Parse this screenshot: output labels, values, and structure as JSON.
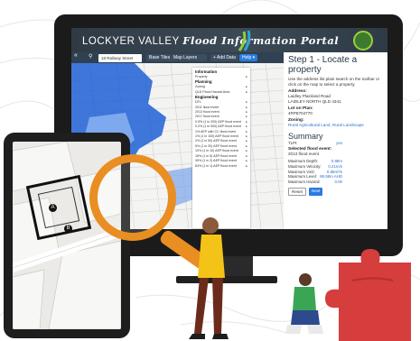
{
  "app": {
    "title_prefix": "LOCKYER VALLEY",
    "title_suffix": "Flood Information Portal"
  },
  "toolbar": {
    "search_value": "18 Railway Street",
    "base_tiles_label": "Base Tiles ▾",
    "map_layers_label": "Map Layers ▾",
    "add_data_label": "+ Add Data",
    "help_label": "Help ▾"
  },
  "layer_menu": {
    "sections": [
      {
        "title": "Information",
        "items": [
          "Property"
        ]
      },
      {
        "title": "Planning",
        "items": [
          "Zoning",
          "QLD Flood Hazard Area"
        ]
      },
      {
        "title": "Engineering",
        "items": [
          "DFL",
          "2011 flood event",
          "2013 flood event",
          "2017 flood event",
          "0.5% (1 in 200) AEP flood event",
          "0.2% (1 in 500) AEP flood event",
          "1% AEP with CC flood event",
          "1% (1 in 100) AEP flood event",
          "2% (1 in 50) AEP flood event",
          "5% (1 in 20) AEP flood event",
          "10% (1 in 10) AEP flood event",
          "18% (1 in 5) AEP flood event",
          "39% (1 in 2) AEP flood event",
          "63% (1 in 1) AEP flood event"
        ]
      }
    ]
  },
  "panel": {
    "heading": "Step 1 - Locate a property",
    "instructions": "Use the address list plain search on the toolbar or click on the map to select a property.",
    "address_label": "Address:",
    "address_lines": [
      "Laidley Plainland Road",
      "LAIDLEY NORTH QLD 4341"
    ],
    "lot_label": "Lot on Plan:",
    "lot_value": "4RP8704770",
    "zoning_label": "Zoning:",
    "zoning_value": "Rural Agricultural Land, Rural Landscape",
    "summary_heading": "Summary",
    "summary_rows": [
      {
        "label": "TLPI:",
        "value": "yes"
      },
      {
        "label": "Selected flood event:",
        "value": "2013 flood event"
      }
    ],
    "metrics": [
      {
        "label": "Maximum Depth:",
        "value": "0.88m"
      },
      {
        "label": "Maximum Velocity:",
        "value": "0.21m/s"
      },
      {
        "label": "Maximum VxD:",
        "value": "0.88m²/s"
      },
      {
        "label": "Maximum Level:",
        "value": "98.58m AHD"
      },
      {
        "label": "Maximum Hazard:",
        "value": "0.00"
      }
    ],
    "reset_label": "Reset",
    "next_label": "Next"
  },
  "tablet_markers": [
    "A",
    "B"
  ],
  "colors": {
    "accent_blue": "#2b7be0",
    "flood_blue": "#1f5fd6",
    "magnifier_orange": "#e98e22",
    "puzzle_red": "#d63d3d",
    "topbar": "#2f3a44"
  }
}
